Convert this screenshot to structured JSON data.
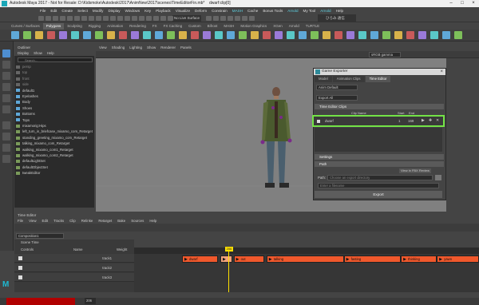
{
  "window": {
    "title": "Autodesk Maya 2017 - Not for Resale: D:\\Kidsmoke\\Autodesk\\2017\\AnimNew\\2017\\scenes\\TimeEditorFin.mb*",
    "object": "dwarf:clip[0]"
  },
  "menubar": {
    "mode": "Animation",
    "items": [
      "File",
      "Edit",
      "Create",
      "Select",
      "Modify",
      "Display",
      "Windows",
      "Key",
      "Playback",
      "Visualize",
      "Deform",
      "Constrain",
      "MASH",
      "Cache",
      "Bonus Tools",
      "Arnold",
      "My Tool",
      "Arnold",
      "Help"
    ],
    "highlight": [
      "MASH",
      "Arnold"
    ]
  },
  "status": {
    "no_live": "No Live Surface",
    "user": "ひろみ 通信"
  },
  "shelf": {
    "tabs": [
      "Curves / Surfaces",
      "Polygons",
      "Sculpting",
      "Rigging",
      "Animation",
      "Rendering",
      "FX",
      "FX Caching",
      "Custom",
      "Bifrost",
      "MASH",
      "Motion Graphics",
      "XGen",
      "Arnold",
      "TURTLE"
    ],
    "active": "Polygons"
  },
  "outliner": {
    "title": "Outliner",
    "menu": [
      "Display",
      "Show",
      "Help"
    ],
    "search_placeholder": "Search...",
    "items": [
      {
        "label": "persp",
        "color": "#888"
      },
      {
        "label": "top",
        "color": "#888"
      },
      {
        "label": "front",
        "color": "#888"
      },
      {
        "label": "side",
        "color": "#888"
      },
      {
        "label": "default1",
        "color": "#ccc"
      },
      {
        "label": "Eyelashes",
        "color": "#ccc"
      },
      {
        "label": "Body",
        "color": "#ccc"
      },
      {
        "label": "Shoes",
        "color": "#ccc"
      },
      {
        "label": "Bottoms",
        "color": "#ccc"
      },
      {
        "label": "Tops",
        "color": "#ccc"
      },
      {
        "label": "mixamorig:Hips",
        "color": "#ccc"
      },
      {
        "label": "left_turn_in_briefcase_mixamo_com_Retarget",
        "color": "#ccc"
      },
      {
        "label": "standing_greeting_mixamo_com_Retarget",
        "color": "#ccc"
      },
      {
        "label": "talking_mixamo_com_Retarget",
        "color": "#ccc"
      },
      {
        "label": "walking_mixamo_com1_Retarget",
        "color": "#ccc"
      },
      {
        "label": "walking_mixamo_com2_Retarget",
        "color": "#ccc"
      },
      {
        "label": "defaultLightSet",
        "color": "#ccc"
      },
      {
        "label": "defaultObjectSet",
        "color": "#ccc"
      },
      {
        "label": "tweakEditor",
        "color": "#ccc"
      }
    ]
  },
  "viewport": {
    "menu": [
      "View",
      "Shading",
      "Lighting",
      "Show",
      "Renderer",
      "Panels"
    ],
    "colorspace": "sRGB gamma"
  },
  "game_exporter": {
    "title": "Game Exporter",
    "tabs": [
      "Model",
      "Animation Clips",
      "Time Editor"
    ],
    "active_tab": "Time Editor",
    "preset": "Anim Default",
    "export_mode": "Export All",
    "clips_section": "Time Editor Clips",
    "columns": [
      "Clip Name",
      "Start",
      "End"
    ],
    "clip": {
      "name": "dwarf",
      "start": "1",
      "end": "169"
    },
    "settings_section": "Settings",
    "path_section": "Path",
    "view_fbx": "View in FBX Review",
    "path_label": "Path:",
    "path_placeholder": "Choose an export directory",
    "filename_placeholder": "Enter a filename",
    "export_label": "Export"
  },
  "time_editor": {
    "title": "Time Editor",
    "menu": [
      "File",
      "View",
      "Edit",
      "Tracks",
      "Clip",
      "Relinke",
      "Retarget",
      "Bake",
      "Sources",
      "Help"
    ],
    "composition": "Composition1",
    "scene_time": "Scene Time",
    "cols": [
      "Controls",
      "Name",
      "Weight"
    ],
    "tracks": [
      "track1",
      "track2",
      "track3"
    ],
    "playhead": "206",
    "clips": [
      {
        "label": "dwarf",
        "start": 0,
        "end": 46,
        "faded": false
      },
      {
        "label": "",
        "start": 49,
        "end": 64,
        "faded": true
      },
      {
        "label": "out",
        "start": 66,
        "end": 105,
        "faded": false
      },
      {
        "label": "talking",
        "start": 108,
        "end": 207,
        "faded": false
      },
      {
        "label": "fasting",
        "start": 207,
        "end": 280,
        "faded": false
      },
      {
        "label": "thinking",
        "start": 280,
        "end": 326,
        "faded": false
      },
      {
        "label": "yawn",
        "start": 326,
        "end": 380,
        "faded": false
      }
    ]
  },
  "timeline": {
    "range_end": "206"
  }
}
